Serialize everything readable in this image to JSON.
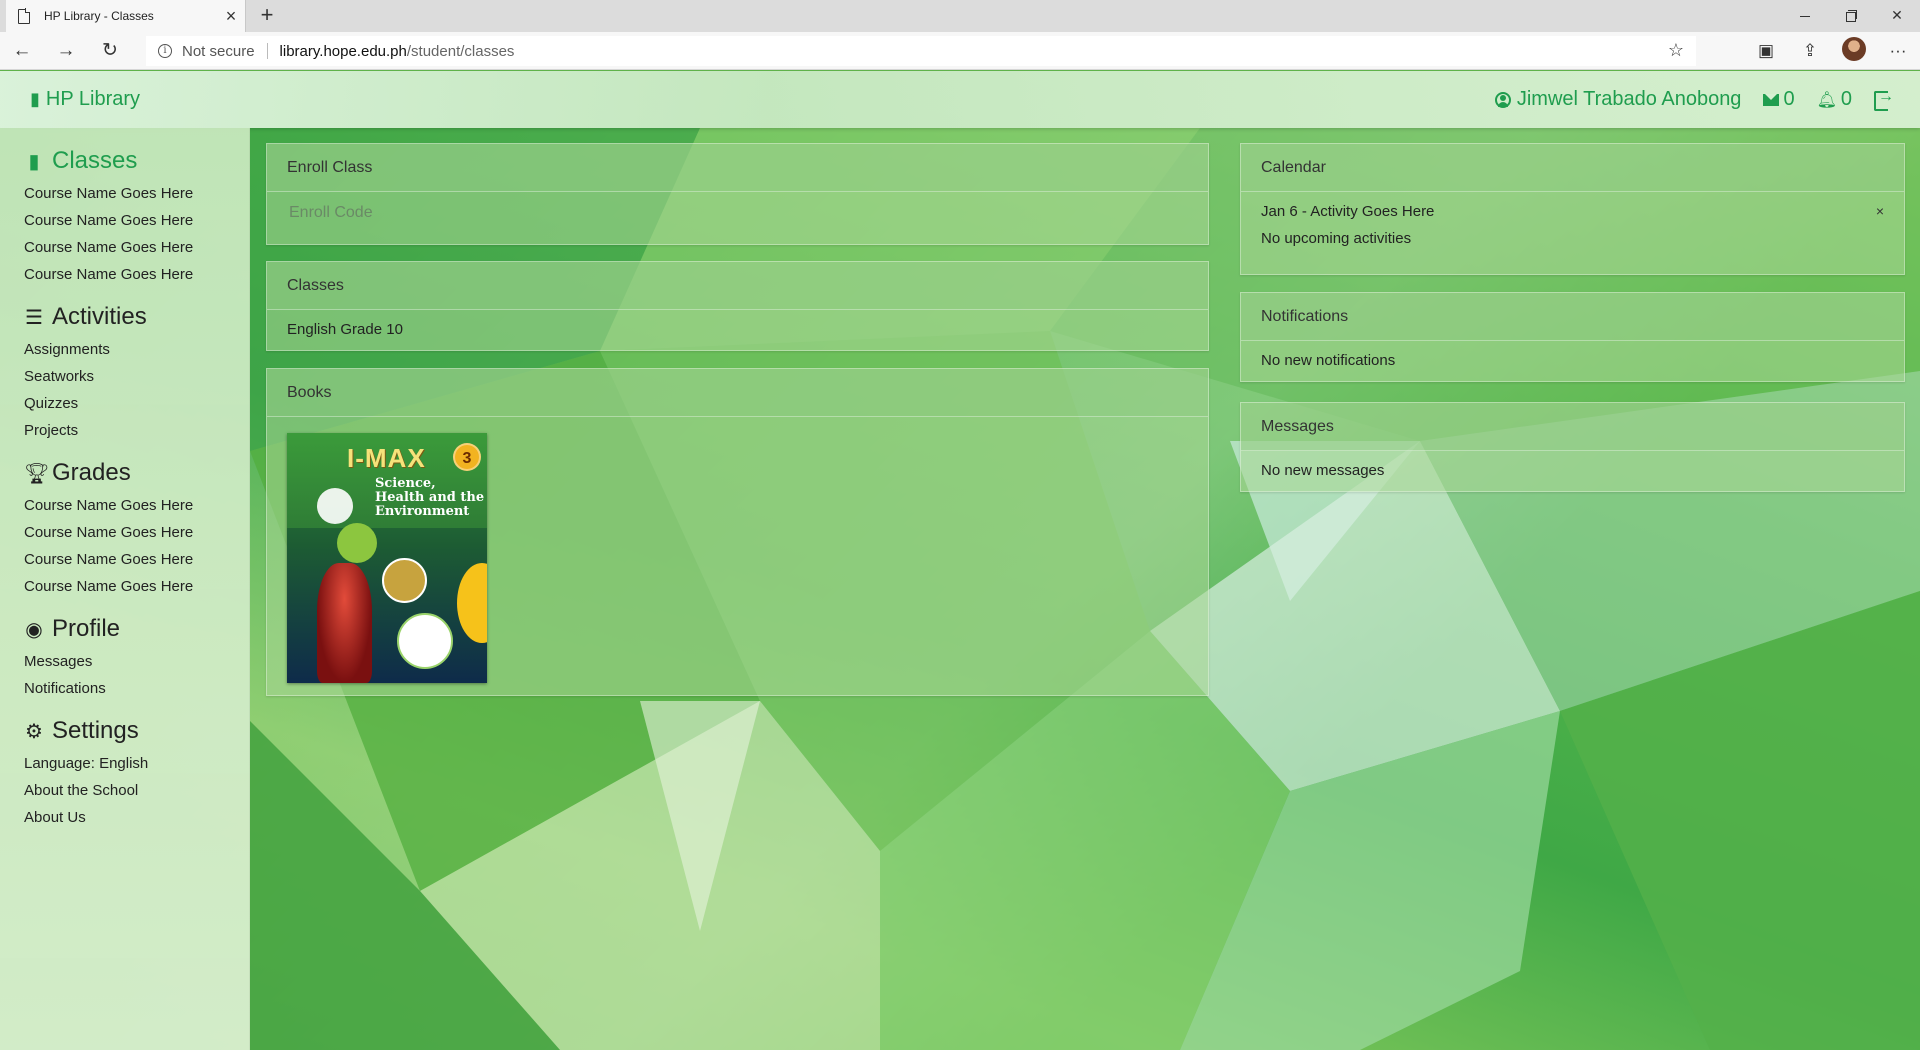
{
  "browser": {
    "tab_title": "HP Library - Classes",
    "tab_close": "×",
    "new_tab": "+",
    "not_secure": "Not secure",
    "url_host": "library.hope.edu.ph",
    "url_path": "/student/classes",
    "back_icon": "←",
    "forward_icon": "→",
    "reload_icon": "↻",
    "star_icon": "☆",
    "more_icon": "···",
    "close_window": "✕"
  },
  "header": {
    "brand": "HP Library",
    "user_name": "Jimwel Trabado Anobong",
    "messages_count": "0",
    "notifications_count": "0"
  },
  "sidebar": {
    "classes": {
      "title": "Classes",
      "items": [
        "Course Name Goes Here",
        "Course Name Goes Here",
        "Course Name Goes Here",
        "Course Name Goes Here"
      ]
    },
    "activities": {
      "title": "Activities",
      "items": [
        "Assignments",
        "Seatworks",
        "Quizzes",
        "Projects"
      ]
    },
    "grades": {
      "title": "Grades",
      "items": [
        "Course Name Goes Here",
        "Course Name Goes Here",
        "Course Name Goes Here",
        "Course Name Goes Here"
      ]
    },
    "profile": {
      "title": "Profile",
      "items": [
        "Messages",
        "Notifications"
      ]
    },
    "settings": {
      "title": "Settings",
      "items": [
        "Language: English",
        "About the School",
        "About Us"
      ]
    }
  },
  "main": {
    "enroll": {
      "title": "Enroll Class",
      "placeholder": "Enroll Code"
    },
    "classes": {
      "title": "Classes",
      "items": [
        "English Grade 10"
      ]
    },
    "books": {
      "title": "Books",
      "cover": {
        "title": "I-MAX",
        "subtitle": "Science, Health and the Environment",
        "volume": "3"
      }
    },
    "calendar": {
      "title": "Calendar",
      "activity": "Jan 6 - Activity Goes Here",
      "close": "×",
      "empty": "No upcoming activities"
    },
    "notifications": {
      "title": "Notifications",
      "empty": "No new notifications"
    },
    "messages": {
      "title": "Messages",
      "empty": "No new messages"
    }
  },
  "colors": {
    "brand_green": "#1f9d4e"
  }
}
